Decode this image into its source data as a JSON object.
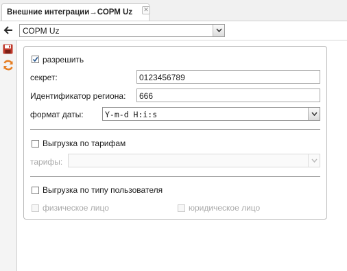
{
  "tab": {
    "title": "Внешние интеграции→СОРМ Uz",
    "close": "✕"
  },
  "nav": {
    "selected": "СОРМ Uz"
  },
  "toolbar": {
    "save_icon": "save-icon",
    "refresh_icon": "refresh-icon"
  },
  "form": {
    "allow": {
      "label": "разрешить",
      "checked": true
    },
    "secret": {
      "label": "секрет:",
      "value": "0123456789"
    },
    "region": {
      "label": "Идентификатор региона:",
      "value": "666"
    },
    "date_format": {
      "label": "формат даты:",
      "value": "Y-m-d H:i:s"
    },
    "by_tariff": {
      "label": "Выгрузка по тарифам",
      "checked": false
    },
    "tariffs": {
      "label": "тарифы:",
      "value": ""
    },
    "by_user_type": {
      "label": "Выгрузка по типу пользователя",
      "checked": false
    },
    "individual": {
      "label": "физическое лицо",
      "checked": false
    },
    "legal": {
      "label": "юридическое лицо",
      "checked": false
    }
  },
  "colors": {
    "save": "#c0392b",
    "refresh": "#e67e22"
  }
}
